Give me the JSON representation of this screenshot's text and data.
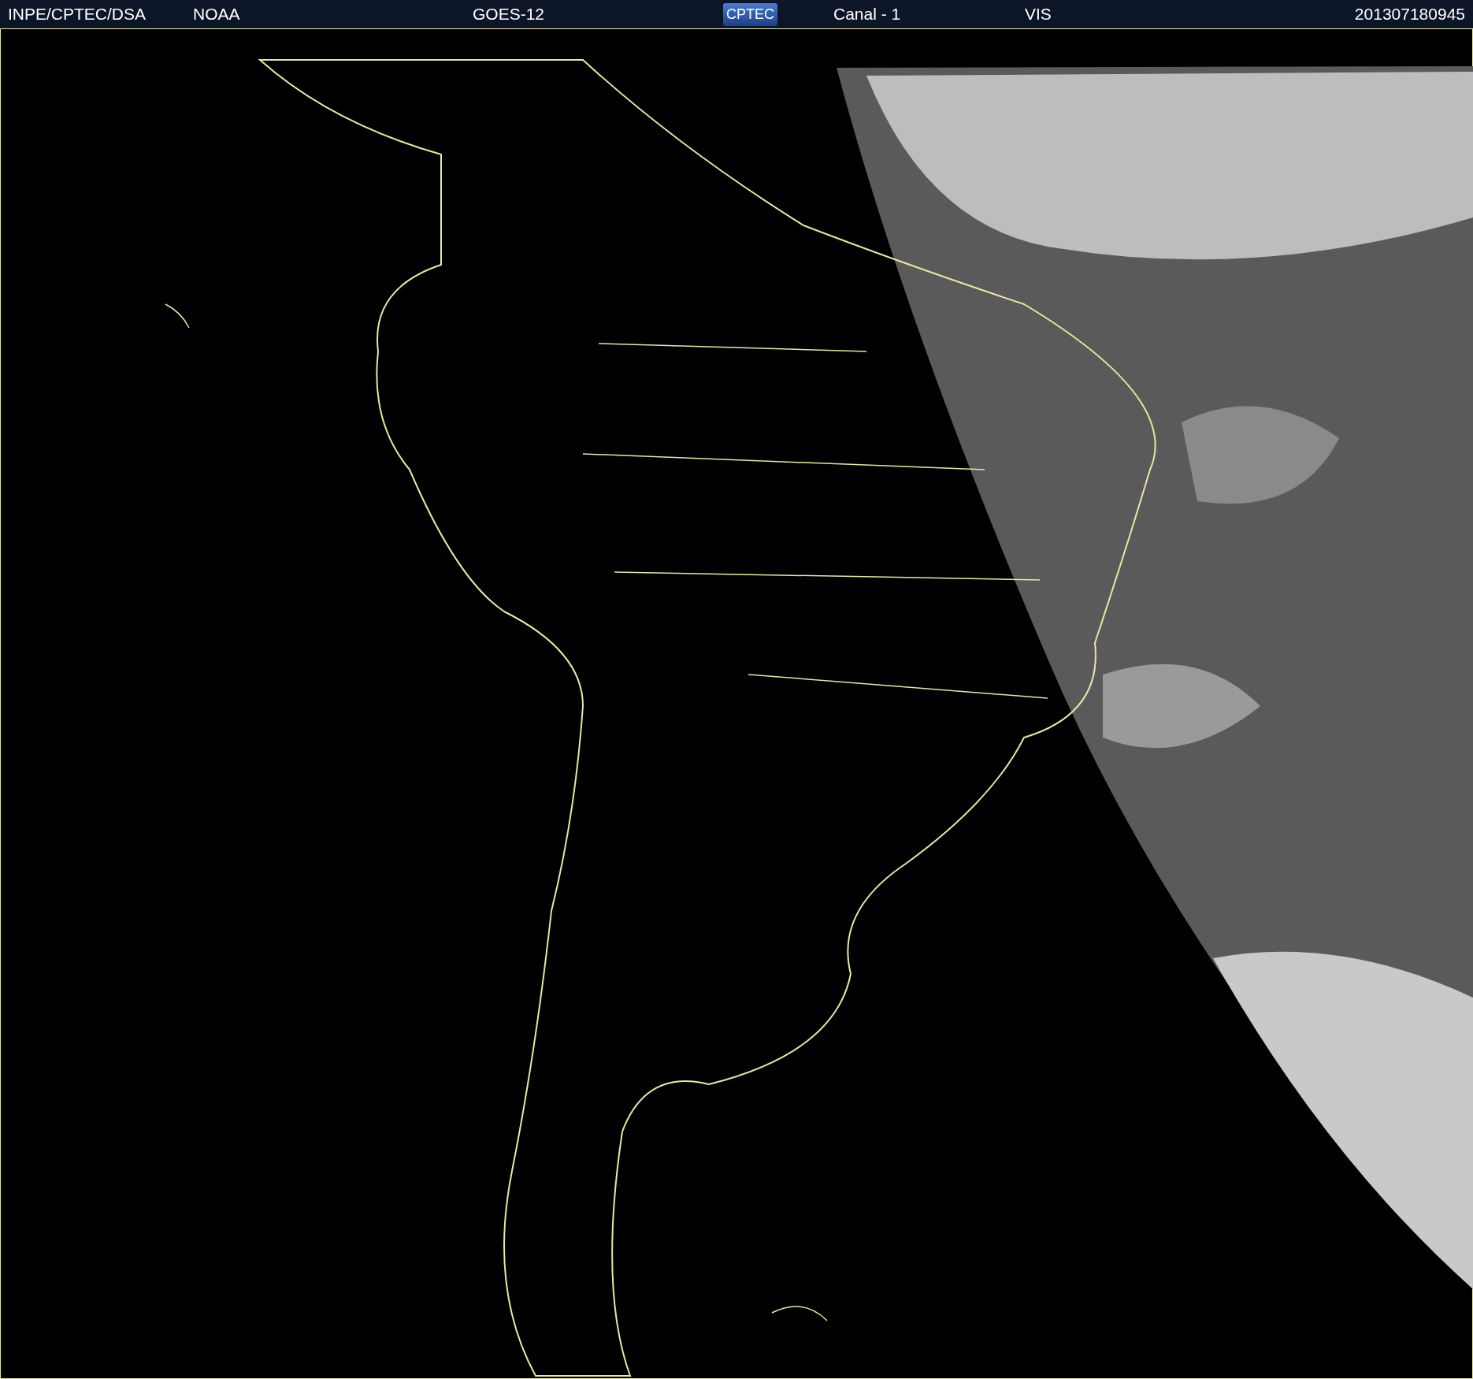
{
  "header": {
    "items": [
      {
        "kind": "text",
        "text": "INPE/CPTEC/DSA"
      },
      {
        "kind": "text",
        "text": "NOAA"
      },
      {
        "kind": "text",
        "text": "GOES-12"
      },
      {
        "kind": "logo",
        "text": "CPTEC"
      },
      {
        "kind": "text",
        "text": "Canal - 1"
      },
      {
        "kind": "text",
        "text": "VIS"
      },
      {
        "kind": "text",
        "text": "201307180945"
      }
    ]
  }
}
